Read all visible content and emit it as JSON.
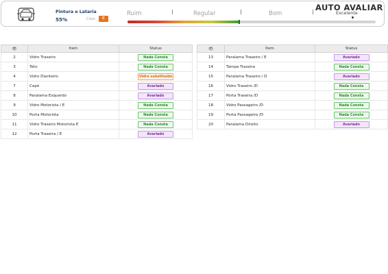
{
  "header": {
    "section_title": "Pintura e Lataria",
    "percentage": "55%",
    "class_label": "Class",
    "class_value": "C",
    "scale": {
      "poor": "Ruim",
      "regular": "Regular",
      "good": "Bom",
      "excellent": "Excelente"
    },
    "score_fraction": 0.45,
    "brand": "AUTO AVALIAR"
  },
  "colors": {
    "nada_consta": "#2c8a2c",
    "avariado": "#7a2f9a",
    "vidro_substituido": "#d26b1a",
    "class_badge": "#e8721a",
    "title": "#1f3f66"
  },
  "left_table": {
    "headers": {
      "icon": "eye-icon",
      "item": "Item",
      "status": "Status"
    },
    "rows": [
      {
        "num": "2",
        "item": "Vidro Traseiro",
        "status": "Nada Consta",
        "kind": "ok"
      },
      {
        "num": "3",
        "item": "Teto",
        "status": "Nada Consta",
        "kind": "ok"
      },
      {
        "num": "4",
        "item": "Vidro Dianteiro",
        "status": "Vidro substituído",
        "kind": "sub"
      },
      {
        "num": "7",
        "item": "Capô",
        "status": "Avariado",
        "kind": "dmg"
      },
      {
        "num": "8",
        "item": "Paralama Esquerdo",
        "status": "Avariado",
        "kind": "dmg"
      },
      {
        "num": "9",
        "item": "Vidro Motorista / E",
        "status": "Nada Consta",
        "kind": "ok"
      },
      {
        "num": "10",
        "item": "Porta Motorista",
        "status": "Nada Consta",
        "kind": "ok"
      },
      {
        "num": "11",
        "item": "Vidro Traseiro Motorista E",
        "status": "Nada Consta",
        "kind": "ok"
      },
      {
        "num": "12",
        "item": "Porta Traseira / E",
        "status": "Avariado",
        "kind": "dmg"
      }
    ]
  },
  "right_table": {
    "headers": {
      "icon": "eye-icon",
      "item": "Item",
      "status": "Status"
    },
    "rows": [
      {
        "num": "13",
        "item": "Paralama Traseiro / E",
        "status": "Avariado",
        "kind": "dmg"
      },
      {
        "num": "14",
        "item": "Tampa Traseira",
        "status": "Nada Consta",
        "kind": "ok"
      },
      {
        "num": "15",
        "item": "Paralama Traseiro / D",
        "status": "Avariado",
        "kind": "dmg"
      },
      {
        "num": "16",
        "item": "Vidro Traseiro /D",
        "status": "Nada Consta",
        "kind": "ok"
      },
      {
        "num": "17",
        "item": "Porta Traseira /D",
        "status": "Nada Consta",
        "kind": "ok"
      },
      {
        "num": "18",
        "item": "Vidro Passageiro /D",
        "status": "Nada Consta",
        "kind": "ok"
      },
      {
        "num": "19",
        "item": "Porta Passageiro /D",
        "status": "Nada Consta",
        "kind": "ok"
      },
      {
        "num": "20",
        "item": "Paralama Direito",
        "status": "Avariado",
        "kind": "dmg"
      }
    ]
  }
}
